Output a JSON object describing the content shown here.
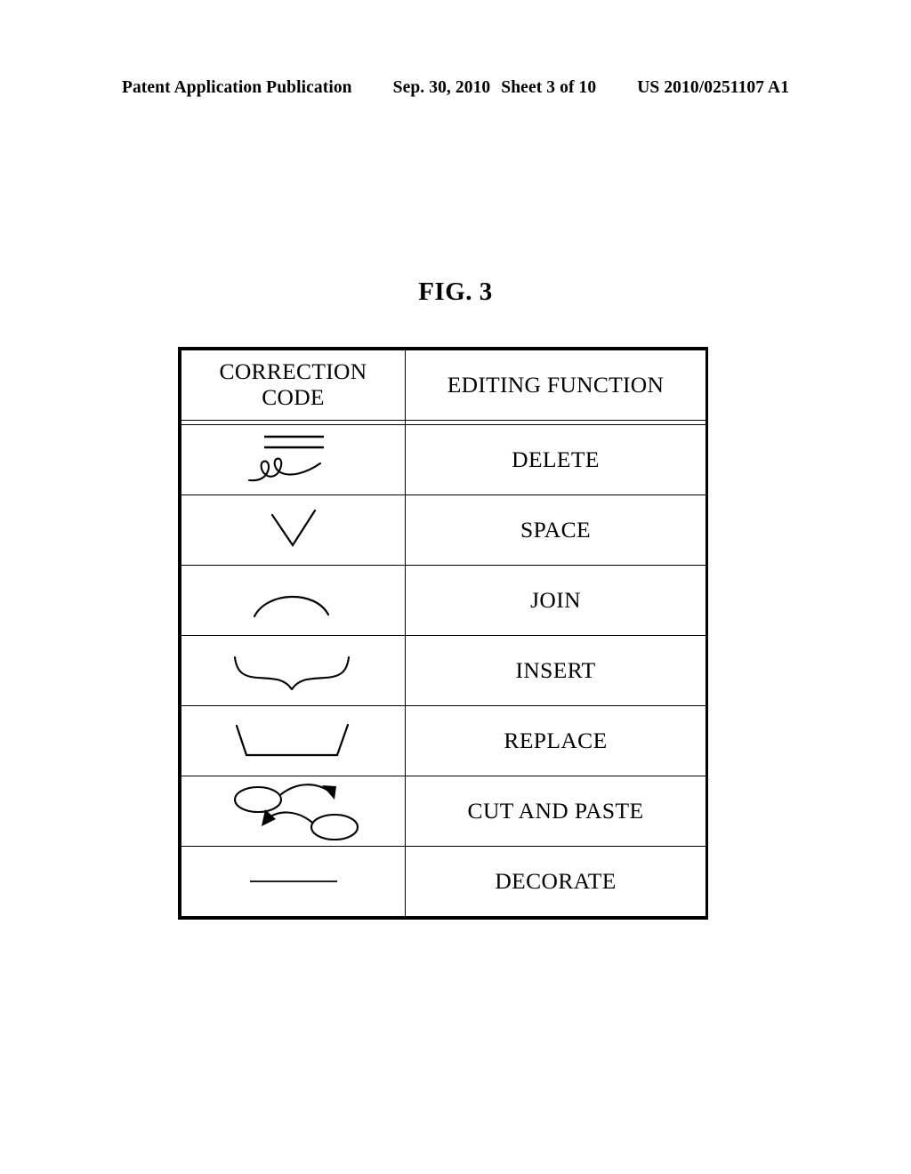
{
  "page": {
    "header": {
      "publication": "Patent Application Publication",
      "date": "Sep. 30, 2010",
      "sheet": "Sheet 3 of 10",
      "patent_number": "US 2010/0251107 A1"
    },
    "figure_label": "FIG. 3"
  },
  "table": {
    "columns": [
      {
        "id": "correction_code",
        "header_line1": "CORRECTION",
        "header_line2": "CODE"
      },
      {
        "id": "editing_function",
        "header": "EDITING FUNCTION"
      }
    ],
    "rows": [
      {
        "symbol": "double-strikethrough-with-loop-stroke",
        "function": "DELETE"
      },
      {
        "symbol": "caret-v-mark",
        "function": "SPACE"
      },
      {
        "symbol": "arc-dome-mark",
        "function": "JOIN"
      },
      {
        "symbol": "brace-with-caret-mark",
        "function": "INSERT"
      },
      {
        "symbol": "open-trapezoid-mark",
        "function": "REPLACE"
      },
      {
        "symbol": "two-ellipses-with-curved-arrows",
        "function": "CUT AND PASTE"
      },
      {
        "symbol": "single-horizontal-line-mark",
        "function": "DECORATE"
      }
    ]
  },
  "colors": {
    "ink": "#000000",
    "paper": "#ffffff"
  }
}
